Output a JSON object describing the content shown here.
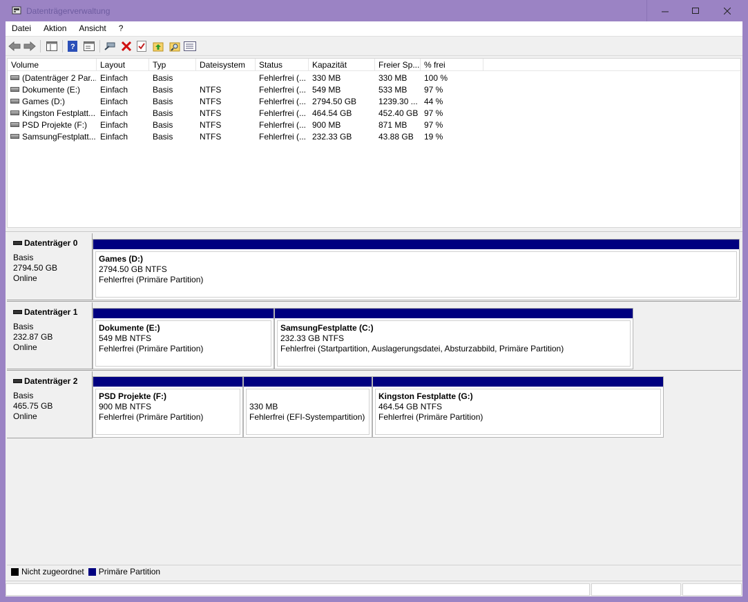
{
  "window": {
    "title": "Datenträgerverwaltung"
  },
  "menu": [
    "Datei",
    "Aktion",
    "Ansicht",
    "?"
  ],
  "toolbar": {
    "icons": [
      "back-arrow-icon",
      "forward-arrow-icon",
      "console-tree-icon",
      "help-icon",
      "properties-icon",
      "connect-icon",
      "delete-icon",
      "check-icon",
      "folder-up-icon",
      "search-folder-icon",
      "list-view-icon"
    ]
  },
  "volume_list": {
    "columns": [
      "Volume",
      "Layout",
      "Typ",
      "Dateisystem",
      "Status",
      "Kapazität",
      "Freier Sp...",
      "% frei"
    ],
    "rows": [
      [
        "(Datenträger 2 Par...",
        "Einfach",
        "Basis",
        "",
        "Fehlerfrei (...",
        "330 MB",
        "330 MB",
        "100 %"
      ],
      [
        "Dokumente (E:)",
        "Einfach",
        "Basis",
        "NTFS",
        "Fehlerfrei (...",
        "549 MB",
        "533 MB",
        "97 %"
      ],
      [
        "Games (D:)",
        "Einfach",
        "Basis",
        "NTFS",
        "Fehlerfrei (...",
        "2794.50 GB",
        "1239.30 ...",
        "44 %"
      ],
      [
        "Kingston Festplatt...",
        "Einfach",
        "Basis",
        "NTFS",
        "Fehlerfrei (...",
        "464.54 GB",
        "452.40 GB",
        "97 %"
      ],
      [
        "PSD Projekte (F:)",
        "Einfach",
        "Basis",
        "NTFS",
        "Fehlerfrei (...",
        "900 MB",
        "871 MB",
        "97 %"
      ],
      [
        "SamsungFestplatt...",
        "Einfach",
        "Basis",
        "NTFS",
        "Fehlerfrei (...",
        "232.33 GB",
        "43.88 GB",
        "19 %"
      ]
    ]
  },
  "disks": [
    {
      "name": "Datenträger 0",
      "type": "Basis",
      "size": "2794.50 GB",
      "state": "Online",
      "partitions": [
        {
          "title": "Games  (D:)",
          "line2": "2794.50 GB NTFS",
          "line3": "Fehlerfrei (Primäre Partition)"
        }
      ]
    },
    {
      "name": "Datenträger 1",
      "type": "Basis",
      "size": "232.87 GB",
      "state": "Online",
      "partitions": [
        {
          "title": "Dokumente  (E:)",
          "line2": "549 MB NTFS",
          "line3": "Fehlerfrei (Primäre Partition)"
        },
        {
          "title": "SamsungFestplatte  (C:)",
          "line2": "232.33 GB NTFS",
          "line3": "Fehlerfrei (Startpartition, Auslagerungsdatei, Absturzabbild, Primäre Partition)"
        }
      ]
    },
    {
      "name": "Datenträger 2",
      "type": "Basis",
      "size": "465.75 GB",
      "state": "Online",
      "partitions": [
        {
          "title": "PSD Projekte  (F:)",
          "line2": "900 MB NTFS",
          "line3": "Fehlerfrei (Primäre Partition)"
        },
        {
          "title": "",
          "line2": "330 MB",
          "line3": "Fehlerfrei (EFI-Systempartition)"
        },
        {
          "title": "Kingston Festplatte  (G:)",
          "line2": "464.54 GB NTFS",
          "line3": "Fehlerfrei (Primäre Partition)"
        }
      ]
    }
  ],
  "legend": [
    {
      "label": "Nicht zugeordnet",
      "color": "#000000"
    },
    {
      "label": "Primäre Partition",
      "color": "#000080"
    }
  ],
  "colors": {
    "titlebar": "#9b83c4",
    "primary_partition": "#000080"
  }
}
